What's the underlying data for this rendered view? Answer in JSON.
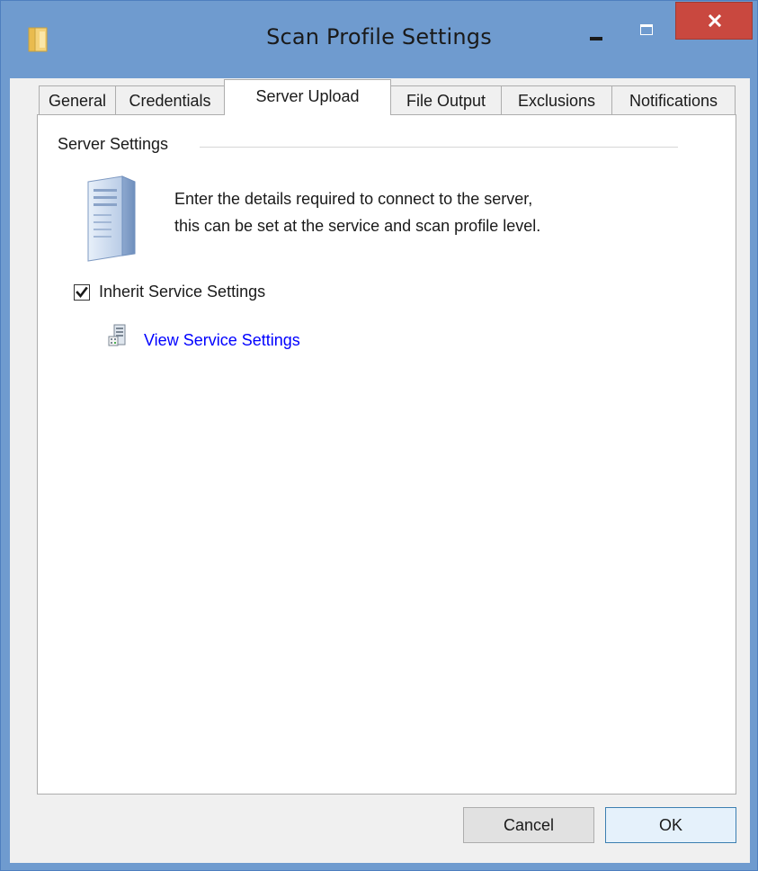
{
  "window": {
    "title": "Scan Profile Settings"
  },
  "tabs": [
    {
      "label": "General"
    },
    {
      "label": "Credentials"
    },
    {
      "label": "Server Upload"
    },
    {
      "label": "File Output"
    },
    {
      "label": "Exclusions"
    },
    {
      "label": "Notifications"
    }
  ],
  "active_tab": "Server Upload",
  "server_settings": {
    "group_title": "Server Settings",
    "description_line1": "Enter the details required to connect to the server,",
    "description_line2": "this can be set at the service and scan profile level.",
    "inherit_checkbox_label": "Inherit Service Settings",
    "inherit_checked": true,
    "view_link": "View Service Settings"
  },
  "buttons": {
    "cancel": "Cancel",
    "ok": "OK"
  },
  "colors": {
    "title_bar": "#6f9bcf",
    "close_button": "#c9483f",
    "link": "#0000ff",
    "dialog_background": "#f0f0f0"
  },
  "icons": [
    "folder-icon",
    "minimize-icon",
    "maximize-icon",
    "close-icon",
    "server-icon",
    "checkmark-icon",
    "server-settings-icon"
  ]
}
